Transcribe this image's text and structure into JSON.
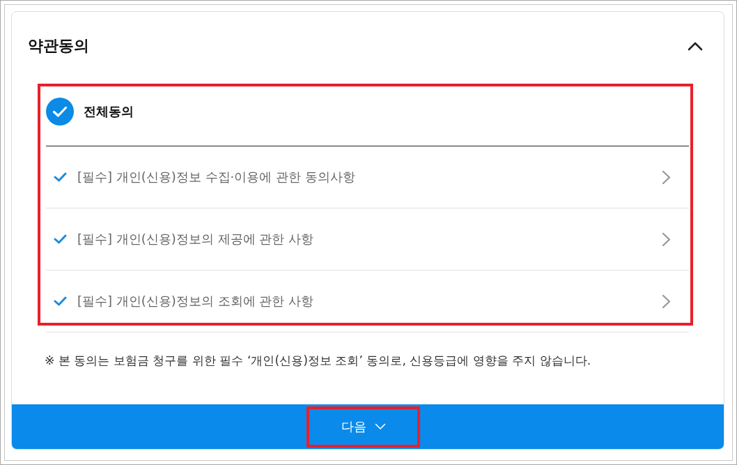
{
  "section": {
    "title": "약관동의",
    "expanded": true
  },
  "terms": {
    "highlighted": true,
    "all_agree": {
      "label": "전체동의",
      "checked": true
    },
    "items": [
      {
        "label": "[필수] 개인(신용)정보 수집·이용에 관한 동의사항",
        "checked": true
      },
      {
        "label": "[필수] 개인(신용)정보의 제공에 관한 사항",
        "checked": true
      },
      {
        "label": "[필수] 개인(신용)정보의 조회에 관한 사항",
        "checked": true
      }
    ]
  },
  "notice": "※ 본 동의는 보험금 청구를 위한 필수 ‘개인(신용)정보 조회’ 동의로, 신용등급에 영향을 주지 않습니다.",
  "next_button": {
    "label": "다음",
    "highlighted": true
  }
}
